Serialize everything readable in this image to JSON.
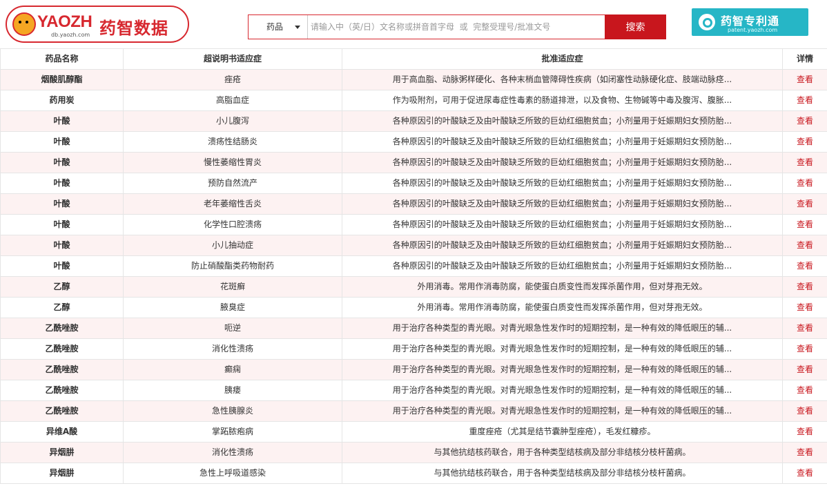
{
  "header": {
    "logo_text": "YAOZH",
    "logo_domain": "db.yaozh.com",
    "logo_cn": "药智数据",
    "patent_cn": "药智专利通",
    "patent_domain": "patent.yaozh.com"
  },
  "search": {
    "category": "药品",
    "placeholder": "请输入中（英/日）文名称或拼音首字母  或  完整受理号/批准文号",
    "button": "搜索"
  },
  "table": {
    "columns": [
      "药品名称",
      "超说明书适应症",
      "批准适应症",
      "详情"
    ],
    "detail_label": "查看",
    "rows": [
      {
        "name": "烟酸肌醇酯",
        "off_label": "痤疮",
        "approved": "用于高血脂、动脉粥样硬化、各种末梢血管障碍性疾病（如闭塞性动脉硬化症、肢端动脉痉..."
      },
      {
        "name": "药用炭",
        "off_label": "高脂血症",
        "approved": "作为吸附剂，可用于促进尿毒症性毒素的肠道排泄，以及食物、生物碱等中毒及腹泻、腹胀..."
      },
      {
        "name": "叶酸",
        "off_label": "小儿腹泻",
        "approved": "各种原因引的叶酸缺乏及由叶酸缺乏所致的巨幼红细胞贫血；小剂量用于妊娠期妇女预防胎..."
      },
      {
        "name": "叶酸",
        "off_label": "溃疡性结肠炎",
        "approved": "各种原因引的叶酸缺乏及由叶酸缺乏所致的巨幼红细胞贫血；小剂量用于妊娠期妇女预防胎..."
      },
      {
        "name": "叶酸",
        "off_label": "慢性萎缩性胃炎",
        "approved": "各种原因引的叶酸缺乏及由叶酸缺乏所致的巨幼红细胞贫血；小剂量用于妊娠期妇女预防胎..."
      },
      {
        "name": "叶酸",
        "off_label": "预防自然流产",
        "approved": "各种原因引的叶酸缺乏及由叶酸缺乏所致的巨幼红细胞贫血；小剂量用于妊娠期妇女预防胎..."
      },
      {
        "name": "叶酸",
        "off_label": "老年萎缩性舌炎",
        "approved": "各种原因引的叶酸缺乏及由叶酸缺乏所致的巨幼红细胞贫血；小剂量用于妊娠期妇女预防胎..."
      },
      {
        "name": "叶酸",
        "off_label": "化学性口腔溃疡",
        "approved": "各种原因引的叶酸缺乏及由叶酸缺乏所致的巨幼红细胞贫血；小剂量用于妊娠期妇女预防胎..."
      },
      {
        "name": "叶酸",
        "off_label": "小儿抽动症",
        "approved": "各种原因引的叶酸缺乏及由叶酸缺乏所致的巨幼红细胞贫血；小剂量用于妊娠期妇女预防胎..."
      },
      {
        "name": "叶酸",
        "off_label": "防止硝酸酯类药物耐药",
        "approved": "各种原因引的叶酸缺乏及由叶酸缺乏所致的巨幼红细胞贫血；小剂量用于妊娠期妇女预防胎..."
      },
      {
        "name": "乙醇",
        "off_label": "花斑癣",
        "approved": "外用消毒。常用作消毒防腐，能使蛋白质变性而发挥杀菌作用，但对芽孢无效。"
      },
      {
        "name": "乙醇",
        "off_label": "腋臭症",
        "approved": "外用消毒。常用作消毒防腐，能使蛋白质变性而发挥杀菌作用，但对芽孢无效。"
      },
      {
        "name": "乙酰唑胺",
        "off_label": "呃逆",
        "approved": "用于治疗各种类型的青光眼。对青光眼急性发作时的短期控制，是一种有效的降低眼压的辅..."
      },
      {
        "name": "乙酰唑胺",
        "off_label": "消化性溃疡",
        "approved": "用于治疗各种类型的青光眼。对青光眼急性发作时的短期控制，是一种有效的降低眼压的辅..."
      },
      {
        "name": "乙酰唑胺",
        "off_label": "癫痫",
        "approved": "用于治疗各种类型的青光眼。对青光眼急性发作时的短期控制，是一种有效的降低眼压的辅..."
      },
      {
        "name": "乙酰唑胺",
        "off_label": "胰瘘",
        "approved": "用于治疗各种类型的青光眼。对青光眼急性发作时的短期控制，是一种有效的降低眼压的辅..."
      },
      {
        "name": "乙酰唑胺",
        "off_label": "急性胰腺炎",
        "approved": "用于治疗各种类型的青光眼。对青光眼急性发作时的短期控制，是一种有效的降低眼压的辅..."
      },
      {
        "name": "异维A酸",
        "off_label": "掌跖脓疱病",
        "approved": "重度痤疮（尤其是结节囊肿型痤疮），毛发红糠疹。"
      },
      {
        "name": "异烟肼",
        "off_label": "消化性溃疡",
        "approved": "与其他抗结核药联合，用于各种类型结核病及部分非结核分枝杆菌病。"
      },
      {
        "name": "异烟肼",
        "off_label": "急性上呼吸道感染",
        "approved": "与其他抗结核药联合，用于各种类型结核病及部分非结核分枝杆菌病。"
      }
    ]
  }
}
